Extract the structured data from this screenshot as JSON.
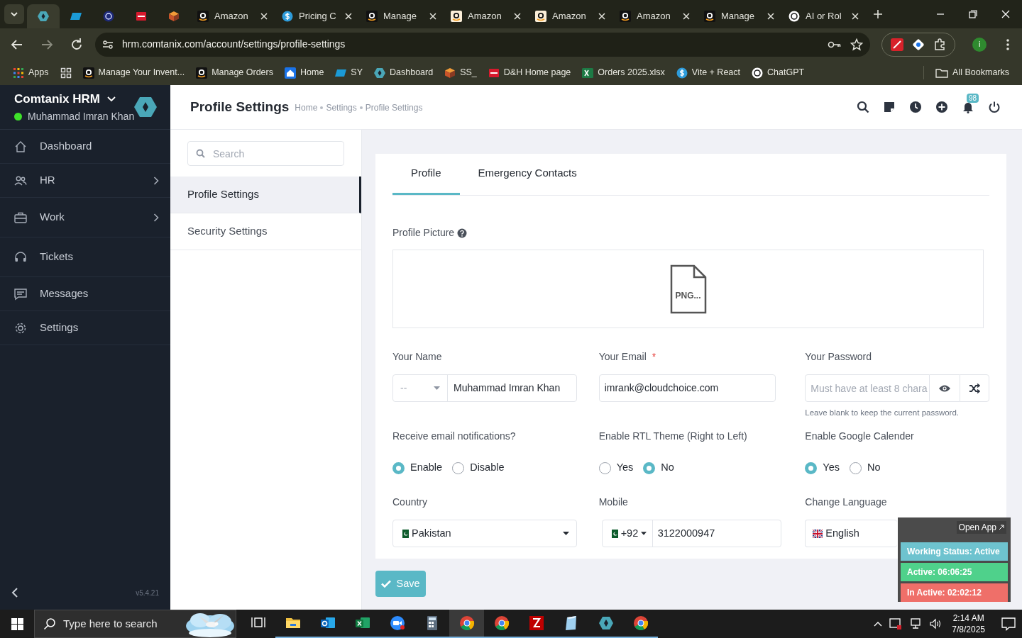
{
  "browser": {
    "tabs": [
      {
        "kind": "hex",
        "selected": true
      },
      {
        "kind": "ec",
        "selected": false
      },
      {
        "kind": "tau",
        "selected": false
      },
      {
        "kind": "dh",
        "selected": false
      },
      {
        "kind": "box",
        "selected": false
      },
      {
        "kind": "amazon",
        "title": "Amazon",
        "selected": false
      },
      {
        "kind": "dollar",
        "title": "Pricing C",
        "selected": false
      },
      {
        "kind": "amazon",
        "title": "Manage",
        "selected": false
      },
      {
        "kind": "amazon_light",
        "title": "Amazon",
        "selected": false
      },
      {
        "kind": "amazon_light",
        "title": "Amazon",
        "selected": false
      },
      {
        "kind": "amazon",
        "title": "Amazon",
        "selected": false
      },
      {
        "kind": "amazon",
        "title": "Manage",
        "selected": false
      },
      {
        "kind": "openai",
        "title": "AI or Rol",
        "selected": false
      }
    ],
    "url": "hrm.comtanix.com/account/settings/profile-settings",
    "bookmarks": [
      {
        "kind": "apps",
        "label": "Apps"
      },
      {
        "kind": "grid"
      },
      {
        "kind": "amazon",
        "label": "Manage Your Invent..."
      },
      {
        "kind": "amazon",
        "label": "Manage Orders"
      },
      {
        "kind": "home",
        "label": "Home"
      },
      {
        "kind": "ec",
        "label": "SY"
      },
      {
        "kind": "hex",
        "label": "Dashboard"
      },
      {
        "kind": "box",
        "label": "SS_"
      },
      {
        "kind": "dh",
        "label": "D&H Home page"
      },
      {
        "kind": "excel",
        "label": "Orders 2025.xlsx"
      },
      {
        "kind": "dollar",
        "label": "Vite + React"
      },
      {
        "kind": "openai",
        "label": "ChatGPT"
      }
    ],
    "all_bookmarks": "All Bookmarks",
    "profile_initial": "i"
  },
  "sidebar": {
    "app_name": "Comtanix HRM",
    "user": "Muhammad Imran Khan",
    "online": true,
    "items": [
      {
        "kind": "home",
        "label": "Dashboard",
        "expandable": false
      },
      {
        "kind": "users",
        "label": "HR",
        "expandable": true
      },
      {
        "kind": "briefcase",
        "label": "Work",
        "expandable": true
      },
      {
        "kind": "headset",
        "label": "Tickets",
        "expandable": false
      },
      {
        "kind": "message",
        "label": "Messages",
        "expandable": false
      },
      {
        "kind": "gear",
        "label": "Settings",
        "expandable": false
      }
    ],
    "version": "v5.4.21"
  },
  "header": {
    "title": "Profile Settings",
    "breadcrumb": [
      "Home",
      "Settings",
      "Profile Settings"
    ],
    "notifications": "98"
  },
  "settings_menu": {
    "search_placeholder": "Search",
    "items": [
      {
        "label": "Profile Settings",
        "selected": true
      },
      {
        "label": "Security Settings",
        "selected": false
      }
    ]
  },
  "card": {
    "tabs": [
      {
        "label": "Profile",
        "selected": true
      },
      {
        "label": "Emergency Contacts",
        "selected": false
      }
    ],
    "profile_picture": {
      "label": "Profile Picture",
      "file_label": "PNG..."
    },
    "name": {
      "label": "Your Name",
      "prefix": "--",
      "value": "Muhammad Imran Khan"
    },
    "email": {
      "label": "Your Email",
      "required_mark": "*",
      "value": "imrank@cloudchoice.com"
    },
    "password": {
      "label": "Your Password",
      "placeholder": "Must have at least 8 chara",
      "hint": "Leave blank to keep the current password."
    },
    "radio_groups": [
      {
        "label": "Receive email notifications?",
        "options": [
          {
            "label": "Enable",
            "selected": true
          },
          {
            "label": "Disable",
            "selected": false
          }
        ]
      },
      {
        "label": "Enable RTL Theme (Right to Left)",
        "options": [
          {
            "label": "Yes",
            "selected": false
          },
          {
            "label": "No",
            "selected": true
          }
        ]
      },
      {
        "label": "Enable Google Calender",
        "options": [
          {
            "label": "Yes",
            "selected": true
          },
          {
            "label": "No",
            "selected": false
          }
        ]
      }
    ],
    "country": {
      "label": "Country",
      "value": "Pakistan"
    },
    "mobile": {
      "label": "Mobile",
      "code": "+92",
      "value": "3122000947"
    },
    "language": {
      "label": "Change Language",
      "value": "English"
    }
  },
  "save_button": "Save",
  "widget": {
    "open_app": "Open App",
    "statuses": [
      {
        "text": "Working Status: Active",
        "color": "#6ec3cf"
      },
      {
        "text": "Active: 06:06:25",
        "color": "#4fd18b"
      },
      {
        "text": "In Active: 02:02:12",
        "color": "#ef6f69"
      }
    ]
  },
  "taskbar": {
    "search_placeholder": "Type here to search",
    "apps": [
      {
        "kind": "taskview",
        "selected": false
      },
      {
        "kind": "folder",
        "selected": false
      },
      {
        "kind": "outlook",
        "selected": false
      },
      {
        "kind": "excel",
        "selected": false
      },
      {
        "kind": "zoom",
        "selected": false
      },
      {
        "kind": "calculator",
        "selected": false
      },
      {
        "kind": "chrome",
        "selected": true
      },
      {
        "kind": "chrome",
        "selected": false
      },
      {
        "kind": "filezilla",
        "selected": false
      },
      {
        "kind": "notepad",
        "selected": false
      },
      {
        "kind": "hex",
        "selected": false
      },
      {
        "kind": "chrome",
        "selected": false
      }
    ],
    "time": "2:14 AM",
    "date": "7/8/2025"
  }
}
